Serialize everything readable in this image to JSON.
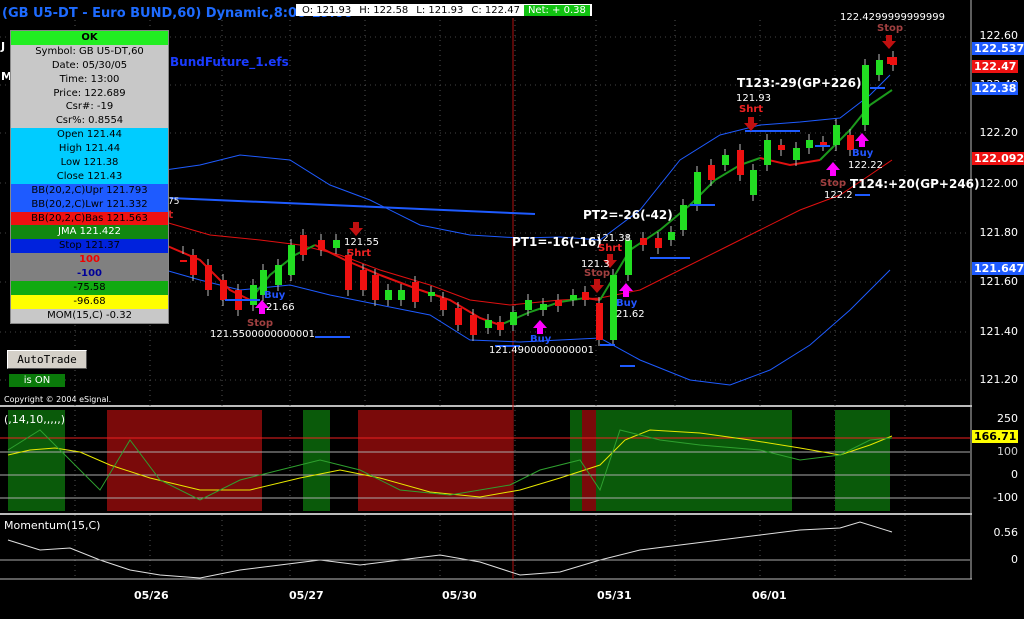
{
  "window": {
    "title": "(GB U5-DT - Euro BUND,60) Dynamic,8:00-19:00",
    "efs_name": "BundFuture_1.efs",
    "stray_letters": [
      "J",
      "M"
    ],
    "fragment_75": "75",
    "fragment_t": "t"
  },
  "ohlc_bar": {
    "open": "O: 121.93",
    "high": "H: 122.58",
    "low": "L: 121.93",
    "close": "C: 122.47",
    "net": "Net: + 0.38"
  },
  "cursor_window": {
    "rows": [
      {
        "text": "OK",
        "bg": "#22ee22",
        "fg": "#000000",
        "bold": true
      },
      {
        "text": "Symbol: GB U5-DT,60",
        "bg": "#c8c8c8",
        "fg": "#000000"
      },
      {
        "text": "Date: 05/30/05",
        "bg": "#c8c8c8",
        "fg": "#000000"
      },
      {
        "text": "Time: 13:00",
        "bg": "#c8c8c8",
        "fg": "#000000"
      },
      {
        "text": "Price: 122.689",
        "bg": "#c8c8c8",
        "fg": "#000000"
      },
      {
        "text": "Csr#: -19",
        "bg": "#c8c8c8",
        "fg": "#000000"
      },
      {
        "text": "Csr%: 0.8554",
        "bg": "#c8c8c8",
        "fg": "#000000"
      },
      {
        "text": "Open 121.44",
        "bg": "#00ccff",
        "fg": "#000000"
      },
      {
        "text": "High 121.44",
        "bg": "#00ccff",
        "fg": "#000000"
      },
      {
        "text": "Low 121.38",
        "bg": "#00ccff",
        "fg": "#000000"
      },
      {
        "text": "Close 121.43",
        "bg": "#00ccff",
        "fg": "#000000"
      },
      {
        "text": "BB(20,2,C)Upr 121.793",
        "bg": "#1e5bff",
        "fg": "#000000"
      },
      {
        "text": "BB(20,2,C)Lwr 121.332",
        "bg": "#1e5bff",
        "fg": "#000000"
      },
      {
        "text": "BB(20,2,C)Bas 121.563",
        "bg": "#ee1111",
        "fg": "#000000"
      },
      {
        "text": "JMA 121.422",
        "bg": "#118811",
        "fg": "#ffffff"
      },
      {
        "text": "Stop 121.37",
        "bg": "#0022dd",
        "fg": "#000000"
      },
      {
        "text": "100",
        "bg": "#808080",
        "fg": "#ee0000",
        "bold": true
      },
      {
        "text": "-100",
        "bg": "#808080",
        "fg": "#000099",
        "bold": true
      },
      {
        "text": "-75.58",
        "bg": "#11aa11",
        "fg": "#000000"
      },
      {
        "text": "-96.68",
        "bg": "#ffff00",
        "fg": "#000000"
      },
      {
        "text": "MOM(15,C) -0.32",
        "bg": "#c8c8c8",
        "fg": "#000000"
      }
    ]
  },
  "buttons": {
    "autotrade": "AutoTrade",
    "status": "is ON"
  },
  "copyright": "Copyright © 2004 eSignal.",
  "price_axis": {
    "ticks": [
      "122.60",
      "122.40",
      "122.20",
      "122.00",
      "121.80",
      "121.60",
      "121.40",
      "121.20"
    ],
    "tags": [
      {
        "text": "122.537",
        "bg": "#1e5bff",
        "fg": "#ffffff"
      },
      {
        "text": "122.47",
        "bg": "#ee1111",
        "fg": "#ffffff"
      },
      {
        "text": "122.38",
        "bg": "#1e5bff",
        "fg": "#ffffff"
      },
      {
        "text": "122.092",
        "bg": "#ee1111",
        "fg": "#ffffff"
      },
      {
        "text": "121.647",
        "bg": "#1e5bff",
        "fg": "#ffffff"
      }
    ]
  },
  "annotations": {
    "pt1": "PT1=-16(-16)",
    "pt2": "PT2=-26(-42)",
    "t123": "T123:-29(GP+226)",
    "t124": "T124:+20(GP+246)",
    "top_price": "122.4299999999999",
    "low1": "121.5500000000001",
    "low2": "121.4900000000001",
    "p12155": "121.55",
    "p12166": "21.66",
    "p12193": "121.93",
    "p1213": "121.3",
    "p12138": "121.38",
    "p12162": "21.62",
    "p12222": "122.22",
    "p1222": "122.2"
  },
  "signals": {
    "buy": "Buy",
    "short": "Shrt",
    "stop": "Stop"
  },
  "osc_panel": {
    "title": "(,14,10,,,,,)",
    "ticks": [
      "250",
      "100",
      "0",
      "-100"
    ],
    "value": "166.71",
    "value_bg": "#ffff00",
    "value2": "100"
  },
  "mom_panel": {
    "title": "Momentum(15,C)",
    "ticks": [
      "0.56",
      "0"
    ]
  },
  "date_axis": {
    "labels": [
      "05/26",
      "05/27",
      "05/30",
      "05/31",
      "06/01"
    ]
  }
}
